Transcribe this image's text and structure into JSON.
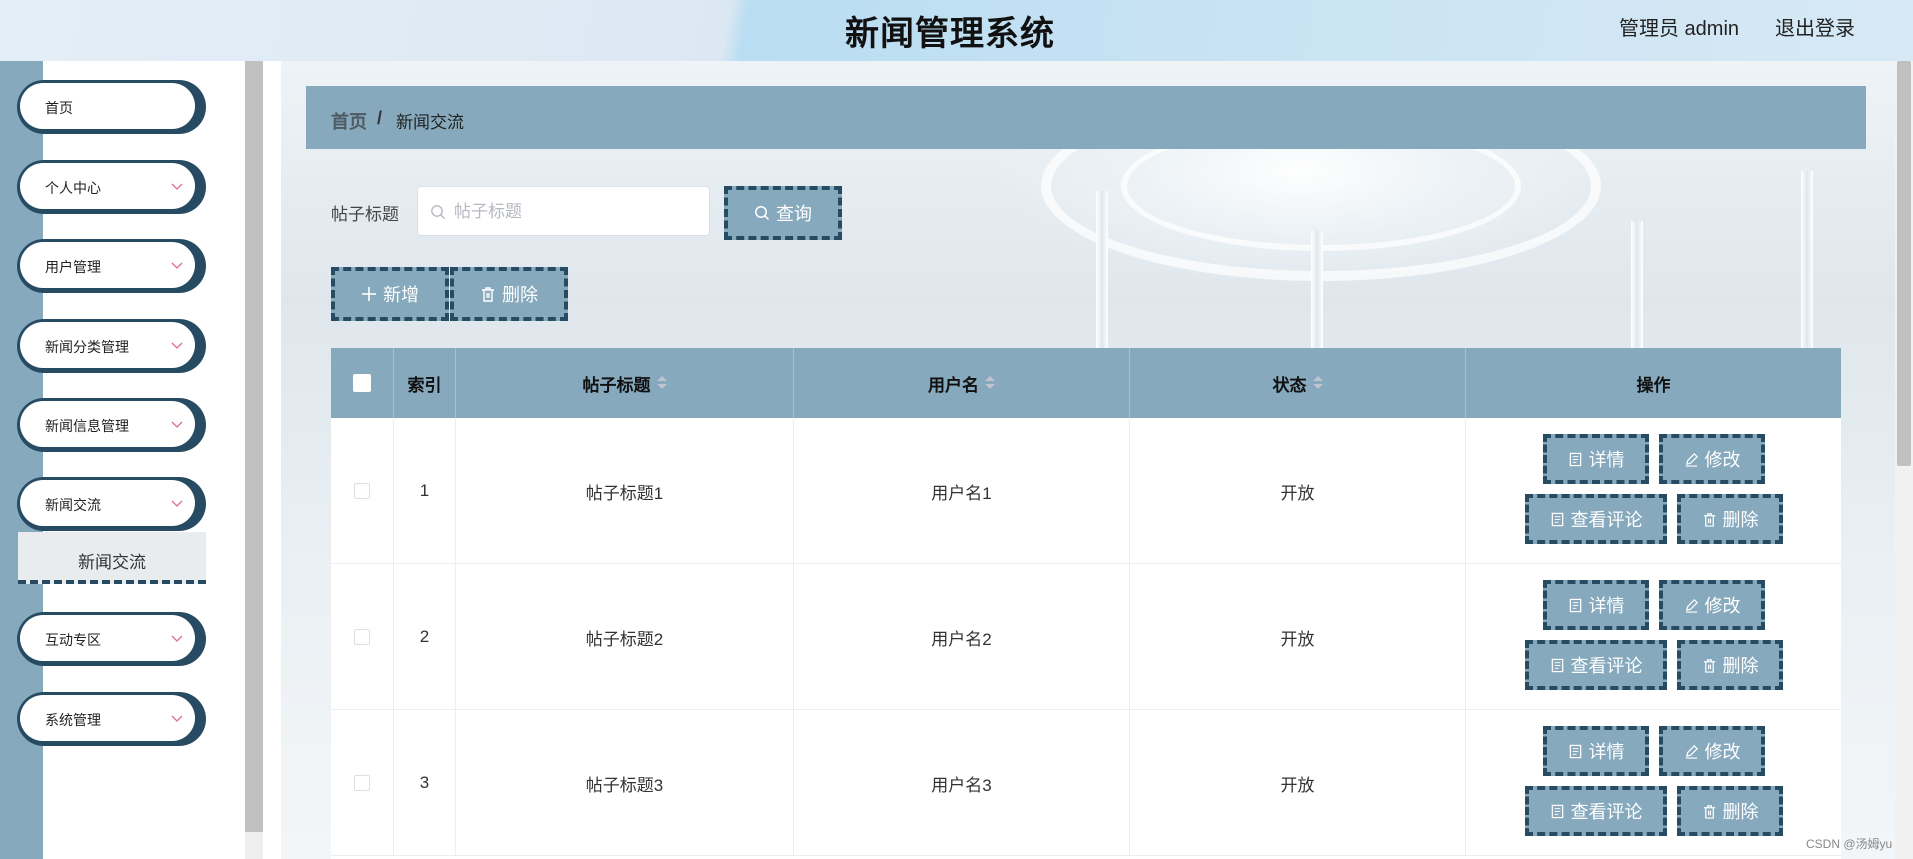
{
  "app": {
    "title": "新闻管理系统",
    "user_label": "管理员 admin",
    "logout_label": "退出登录"
  },
  "sidebar": {
    "items": [
      {
        "label": "首页",
        "icon": "none"
      },
      {
        "label": "个人中心",
        "icon": "chevron-down-icon"
      },
      {
        "label": "用户管理",
        "icon": "chevron-down-icon"
      },
      {
        "label": "新闻分类管理",
        "icon": "chevron-down-icon"
      },
      {
        "label": "新闻信息管理",
        "icon": "chevron-down-icon"
      },
      {
        "label": "新闻交流",
        "icon": "chevron-down-icon"
      },
      {
        "label": "互动专区",
        "icon": "chevron-down-icon"
      },
      {
        "label": "系统管理",
        "icon": "chevron-down-icon"
      }
    ],
    "submenu": {
      "label": "新闻交流"
    }
  },
  "breadcrumb": {
    "home": "首页",
    "separator": "/",
    "current": "新闻交流"
  },
  "search": {
    "label": "帖子标题",
    "placeholder": "帖子标题",
    "value": "",
    "button": "查询"
  },
  "toolbar": {
    "add_label": "新增",
    "delete_label": "删除"
  },
  "table": {
    "columns": [
      "索引",
      "帖子标题",
      "用户名",
      "状态",
      "操作"
    ],
    "rows": [
      {
        "index": "1",
        "title": "帖子标题1",
        "user": "用户名1",
        "status": "开放"
      },
      {
        "index": "2",
        "title": "帖子标题2",
        "user": "用户名2",
        "status": "开放"
      },
      {
        "index": "3",
        "title": "帖子标题3",
        "user": "用户名3",
        "status": "开放"
      }
    ],
    "actions": {
      "detail": "详情",
      "edit": "修改",
      "comments": "查看评论",
      "delete": "删除"
    }
  },
  "watermark": "CSDN @汤姆yu",
  "colors": {
    "accent": "#86a9bd",
    "dark": "#264b63"
  }
}
